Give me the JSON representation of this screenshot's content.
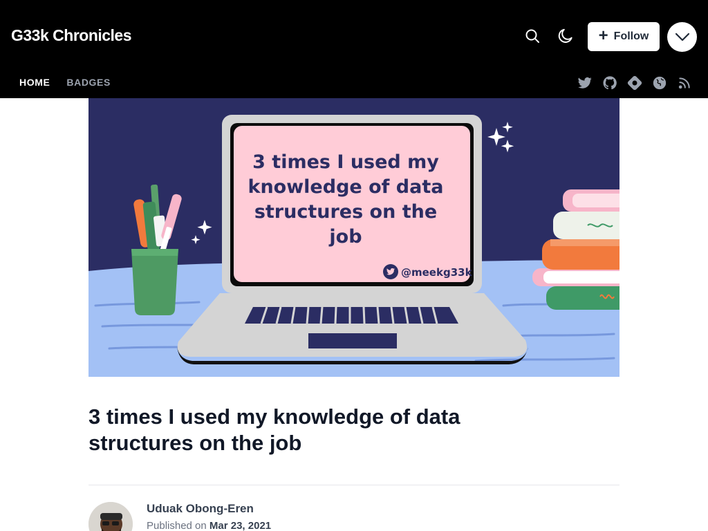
{
  "blog": {
    "name": "G33k Chronicles"
  },
  "header": {
    "search_icon": "search-icon",
    "theme_icon": "moon-icon",
    "follow_label": "Follow",
    "menu_icon": "chevron-down-icon"
  },
  "nav": {
    "items": [
      {
        "label": "HOME",
        "active": true
      },
      {
        "label": "BADGES",
        "active": false
      }
    ]
  },
  "social": [
    "twitter-icon",
    "github-icon",
    "hashnode-icon",
    "globe-icon",
    "rss-icon"
  ],
  "cover": {
    "headline_lines": [
      "3 times I used my",
      "knowledge of data",
      "structures on the",
      "job"
    ],
    "handle": "@meekg33k",
    "colors": {
      "background": "#2b2d63",
      "table": "#a3c1f5",
      "screen": "#ffccd7",
      "laptop": "#d4d4d4"
    }
  },
  "post": {
    "title": "3 times I used my knowledge of data structures on the job",
    "author": "Uduak Obong-Eren",
    "published_prefix": "Published on",
    "published_date": "Mar 23, 2021"
  }
}
